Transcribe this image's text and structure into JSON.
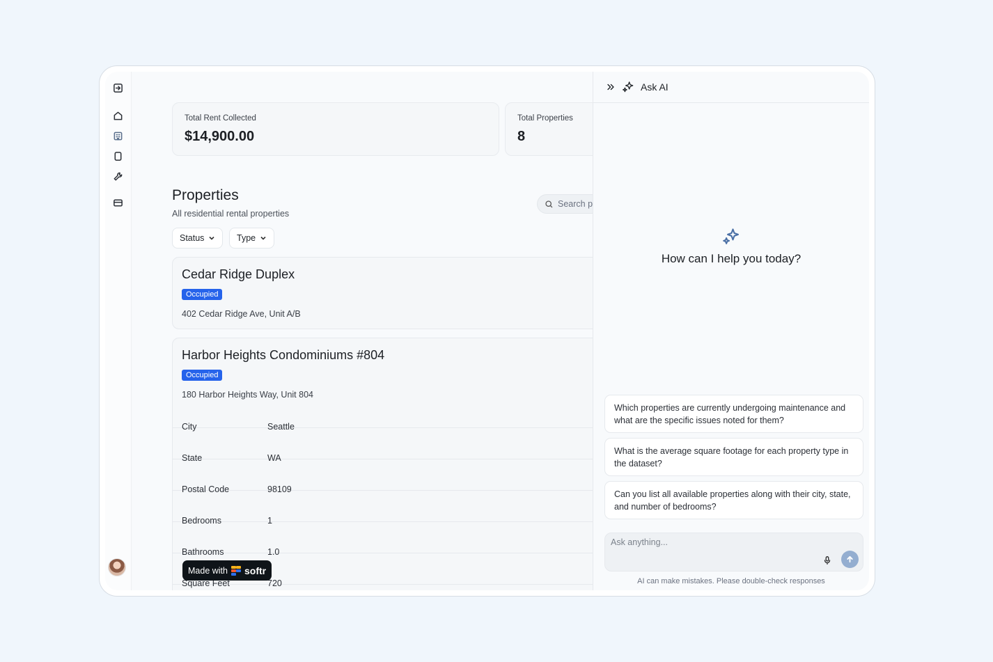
{
  "stats": [
    {
      "label": "Total Rent Collected",
      "value": "$14,900.00"
    },
    {
      "label": "Total Properties",
      "value": "8"
    }
  ],
  "section": {
    "title": "Properties",
    "subtitle": "All residential rental properties"
  },
  "filters": [
    {
      "label": "Status"
    },
    {
      "label": "Type"
    }
  ],
  "search": {
    "placeholder": "Search p"
  },
  "properties": [
    {
      "name": "Cedar Ridge Duplex",
      "status": "Occupied",
      "address": "402 Cedar Ridge Ave, Unit A/B"
    },
    {
      "name": "Harbor Heights Condominiums #804",
      "status": "Occupied",
      "address": "180 Harbor Heights Way, Unit 804",
      "details": [
        {
          "key": "City",
          "value": "Seattle"
        },
        {
          "key": "State",
          "value": "WA"
        },
        {
          "key": "Postal Code",
          "value": "98109"
        },
        {
          "key": "Bedrooms",
          "value": "1"
        },
        {
          "key": "Bathrooms",
          "value": "1.0"
        },
        {
          "key": "Square Feet",
          "value": "720"
        }
      ]
    }
  ],
  "made_with": {
    "text": "Made with",
    "brand": "softr"
  },
  "ai": {
    "title": "Ask AI",
    "prompt": "How can I help you today?",
    "suggestions": [
      "Which properties are currently undergoing maintenance and what are the specific issues noted for them?",
      "What is the average square footage for each property type in the dataset?",
      "Can you list all available properties along with their city, state, and number of bedrooms?"
    ],
    "input_placeholder": "Ask anything...",
    "disclaimer": "AI can make mistakes. Please double-check responses"
  },
  "icons": {
    "rail": [
      "sidebar-toggle-icon",
      "home-icon",
      "building-icon",
      "square-icon",
      "wrench-icon",
      "credit-card-icon"
    ],
    "ai_header": [
      "chevrons-right-icon",
      "sparkles-icon"
    ]
  },
  "colors": {
    "accent": "#2563eb",
    "send_button": "#94aed0",
    "sparkle": "#4a6fa5"
  }
}
